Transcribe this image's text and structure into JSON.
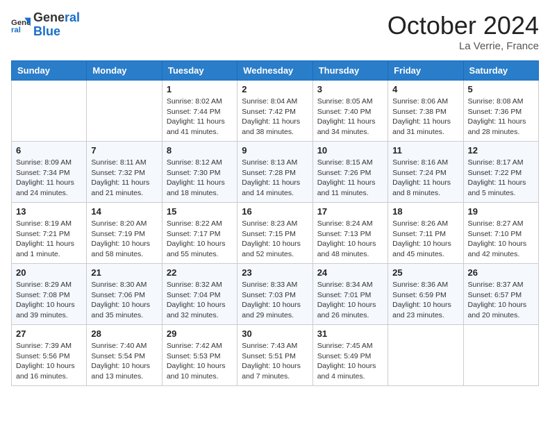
{
  "header": {
    "logo_line1": "General",
    "logo_line2": "Blue",
    "month": "October 2024",
    "location": "La Verrie, France"
  },
  "weekdays": [
    "Sunday",
    "Monday",
    "Tuesday",
    "Wednesday",
    "Thursday",
    "Friday",
    "Saturday"
  ],
  "weeks": [
    [
      {
        "day": "",
        "info": ""
      },
      {
        "day": "",
        "info": ""
      },
      {
        "day": "1",
        "info": "Sunrise: 8:02 AM\nSunset: 7:44 PM\nDaylight: 11 hours and 41 minutes."
      },
      {
        "day": "2",
        "info": "Sunrise: 8:04 AM\nSunset: 7:42 PM\nDaylight: 11 hours and 38 minutes."
      },
      {
        "day": "3",
        "info": "Sunrise: 8:05 AM\nSunset: 7:40 PM\nDaylight: 11 hours and 34 minutes."
      },
      {
        "day": "4",
        "info": "Sunrise: 8:06 AM\nSunset: 7:38 PM\nDaylight: 11 hours and 31 minutes."
      },
      {
        "day": "5",
        "info": "Sunrise: 8:08 AM\nSunset: 7:36 PM\nDaylight: 11 hours and 28 minutes."
      }
    ],
    [
      {
        "day": "6",
        "info": "Sunrise: 8:09 AM\nSunset: 7:34 PM\nDaylight: 11 hours and 24 minutes."
      },
      {
        "day": "7",
        "info": "Sunrise: 8:11 AM\nSunset: 7:32 PM\nDaylight: 11 hours and 21 minutes."
      },
      {
        "day": "8",
        "info": "Sunrise: 8:12 AM\nSunset: 7:30 PM\nDaylight: 11 hours and 18 minutes."
      },
      {
        "day": "9",
        "info": "Sunrise: 8:13 AM\nSunset: 7:28 PM\nDaylight: 11 hours and 14 minutes."
      },
      {
        "day": "10",
        "info": "Sunrise: 8:15 AM\nSunset: 7:26 PM\nDaylight: 11 hours and 11 minutes."
      },
      {
        "day": "11",
        "info": "Sunrise: 8:16 AM\nSunset: 7:24 PM\nDaylight: 11 hours and 8 minutes."
      },
      {
        "day": "12",
        "info": "Sunrise: 8:17 AM\nSunset: 7:22 PM\nDaylight: 11 hours and 5 minutes."
      }
    ],
    [
      {
        "day": "13",
        "info": "Sunrise: 8:19 AM\nSunset: 7:21 PM\nDaylight: 11 hours and 1 minute."
      },
      {
        "day": "14",
        "info": "Sunrise: 8:20 AM\nSunset: 7:19 PM\nDaylight: 10 hours and 58 minutes."
      },
      {
        "day": "15",
        "info": "Sunrise: 8:22 AM\nSunset: 7:17 PM\nDaylight: 10 hours and 55 minutes."
      },
      {
        "day": "16",
        "info": "Sunrise: 8:23 AM\nSunset: 7:15 PM\nDaylight: 10 hours and 52 minutes."
      },
      {
        "day": "17",
        "info": "Sunrise: 8:24 AM\nSunset: 7:13 PM\nDaylight: 10 hours and 48 minutes."
      },
      {
        "day": "18",
        "info": "Sunrise: 8:26 AM\nSunset: 7:11 PM\nDaylight: 10 hours and 45 minutes."
      },
      {
        "day": "19",
        "info": "Sunrise: 8:27 AM\nSunset: 7:10 PM\nDaylight: 10 hours and 42 minutes."
      }
    ],
    [
      {
        "day": "20",
        "info": "Sunrise: 8:29 AM\nSunset: 7:08 PM\nDaylight: 10 hours and 39 minutes."
      },
      {
        "day": "21",
        "info": "Sunrise: 8:30 AM\nSunset: 7:06 PM\nDaylight: 10 hours and 35 minutes."
      },
      {
        "day": "22",
        "info": "Sunrise: 8:32 AM\nSunset: 7:04 PM\nDaylight: 10 hours and 32 minutes."
      },
      {
        "day": "23",
        "info": "Sunrise: 8:33 AM\nSunset: 7:03 PM\nDaylight: 10 hours and 29 minutes."
      },
      {
        "day": "24",
        "info": "Sunrise: 8:34 AM\nSunset: 7:01 PM\nDaylight: 10 hours and 26 minutes."
      },
      {
        "day": "25",
        "info": "Sunrise: 8:36 AM\nSunset: 6:59 PM\nDaylight: 10 hours and 23 minutes."
      },
      {
        "day": "26",
        "info": "Sunrise: 8:37 AM\nSunset: 6:57 PM\nDaylight: 10 hours and 20 minutes."
      }
    ],
    [
      {
        "day": "27",
        "info": "Sunrise: 7:39 AM\nSunset: 5:56 PM\nDaylight: 10 hours and 16 minutes."
      },
      {
        "day": "28",
        "info": "Sunrise: 7:40 AM\nSunset: 5:54 PM\nDaylight: 10 hours and 13 minutes."
      },
      {
        "day": "29",
        "info": "Sunrise: 7:42 AM\nSunset: 5:53 PM\nDaylight: 10 hours and 10 minutes."
      },
      {
        "day": "30",
        "info": "Sunrise: 7:43 AM\nSunset: 5:51 PM\nDaylight: 10 hours and 7 minutes."
      },
      {
        "day": "31",
        "info": "Sunrise: 7:45 AM\nSunset: 5:49 PM\nDaylight: 10 hours and 4 minutes."
      },
      {
        "day": "",
        "info": ""
      },
      {
        "day": "",
        "info": ""
      }
    ]
  ]
}
